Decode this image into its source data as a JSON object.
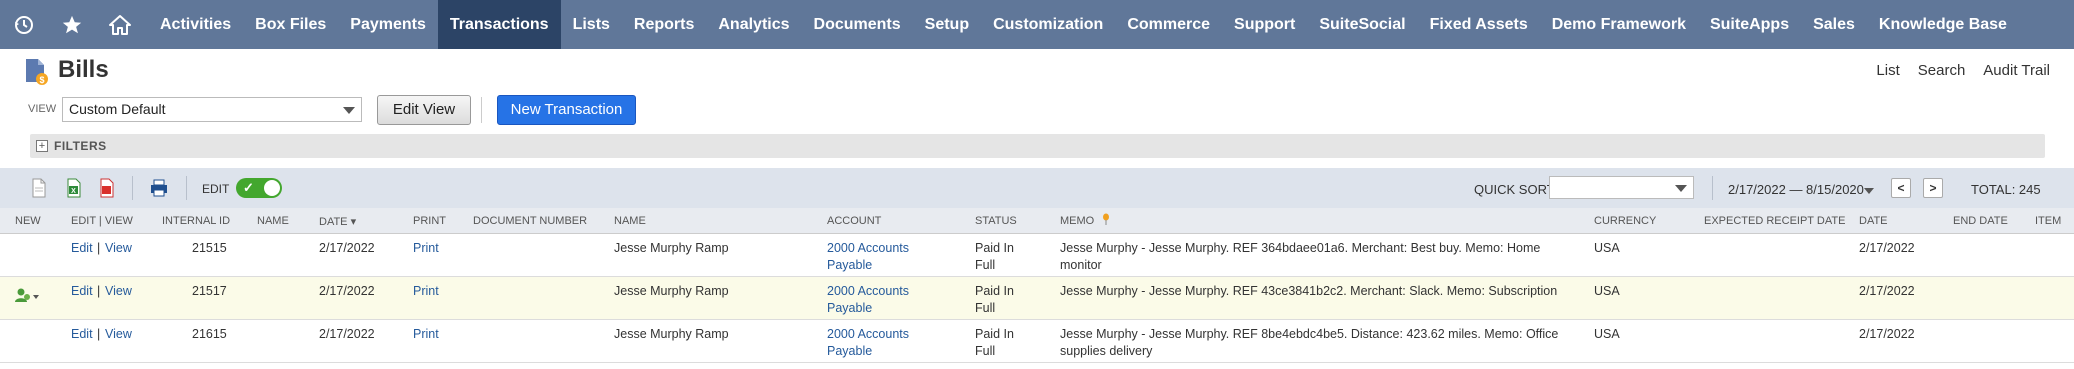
{
  "nav": {
    "items": [
      "Activities",
      "Box Files",
      "Payments",
      "Transactions",
      "Lists",
      "Reports",
      "Analytics",
      "Documents",
      "Setup",
      "Customization",
      "Commerce",
      "Support",
      "SuiteSocial",
      "Fixed Assets",
      "Demo Framework",
      "SuiteApps",
      "Sales",
      "Knowledge Base"
    ],
    "active": "Transactions",
    "icons": [
      "recent-icon",
      "star-icon",
      "home-icon"
    ]
  },
  "page": {
    "title": "Bills",
    "links": [
      "List",
      "Search",
      "Audit Trail"
    ]
  },
  "view": {
    "label": "VIEW",
    "selected": "Custom Default",
    "edit_view_label": "Edit View",
    "new_transaction_label": "New Transaction"
  },
  "filters": {
    "label": "FILTERS"
  },
  "toolbar": {
    "edit_label": "EDIT",
    "quick_sort_label": "QUICK SORT",
    "quick_sort_value": "",
    "date_range": "2/17/2022 — 8/15/2020",
    "prev": "<",
    "next": ">",
    "total": "TOTAL: 245"
  },
  "table": {
    "headers": [
      "New",
      "Edit | View",
      "Internal ID",
      "Name",
      "Date ▾",
      "Print",
      "Document Number",
      "Name",
      "Account",
      "Status",
      "Memo",
      "Currency",
      "Expected Receipt Date",
      "Date",
      "End Date",
      "Item"
    ],
    "rows": [
      {
        "edit": "Edit",
        "view": "View",
        "id": "21515",
        "date": "2/17/2022",
        "print": "Print",
        "name": "Jesse Murphy Ramp",
        "account_1": "2000 Accounts",
        "account_2": "Payable",
        "status_1": "Paid In",
        "status_2": "Full",
        "memo_1": "Jesse Murphy - Jesse Murphy. REF 364bdaee01a6. Merchant: Best buy. Memo: Home",
        "memo_2": "monitor",
        "currency": "USA",
        "date2": "2/17/2022"
      },
      {
        "edit": "Edit",
        "view": "View",
        "id": "21517",
        "date": "2/17/2022",
        "print": "Print",
        "name": "Jesse Murphy Ramp",
        "account_1": "2000 Accounts",
        "account_2": "Payable",
        "status_1": "Paid In",
        "status_2": "Full",
        "memo_1": "Jesse Murphy - Jesse Murphy. REF 43ce3841b2c2. Merchant: Slack. Memo: Subscription",
        "memo_2": "",
        "currency": "USA",
        "date2": "2/17/2022"
      },
      {
        "edit": "Edit",
        "view": "View",
        "id": "21615",
        "date": "2/17/2022",
        "print": "Print",
        "name": "Jesse Murphy Ramp",
        "account_1": "2000 Accounts",
        "account_2": "Payable",
        "status_1": "Paid In",
        "status_2": "Full",
        "memo_1": "Jesse Murphy - Jesse Murphy. REF 8be4ebdc4be5. Distance: 423.62 miles. Memo: Office",
        "memo_2": "supplies delivery",
        "currency": "USA",
        "date2": "2/17/2022"
      }
    ]
  },
  "colors": {
    "nav_bg": "#607799",
    "nav_active": "#2c4466",
    "primary_button": "#2673e6",
    "toggle_on": "#43a72e",
    "link": "#255a9b"
  }
}
